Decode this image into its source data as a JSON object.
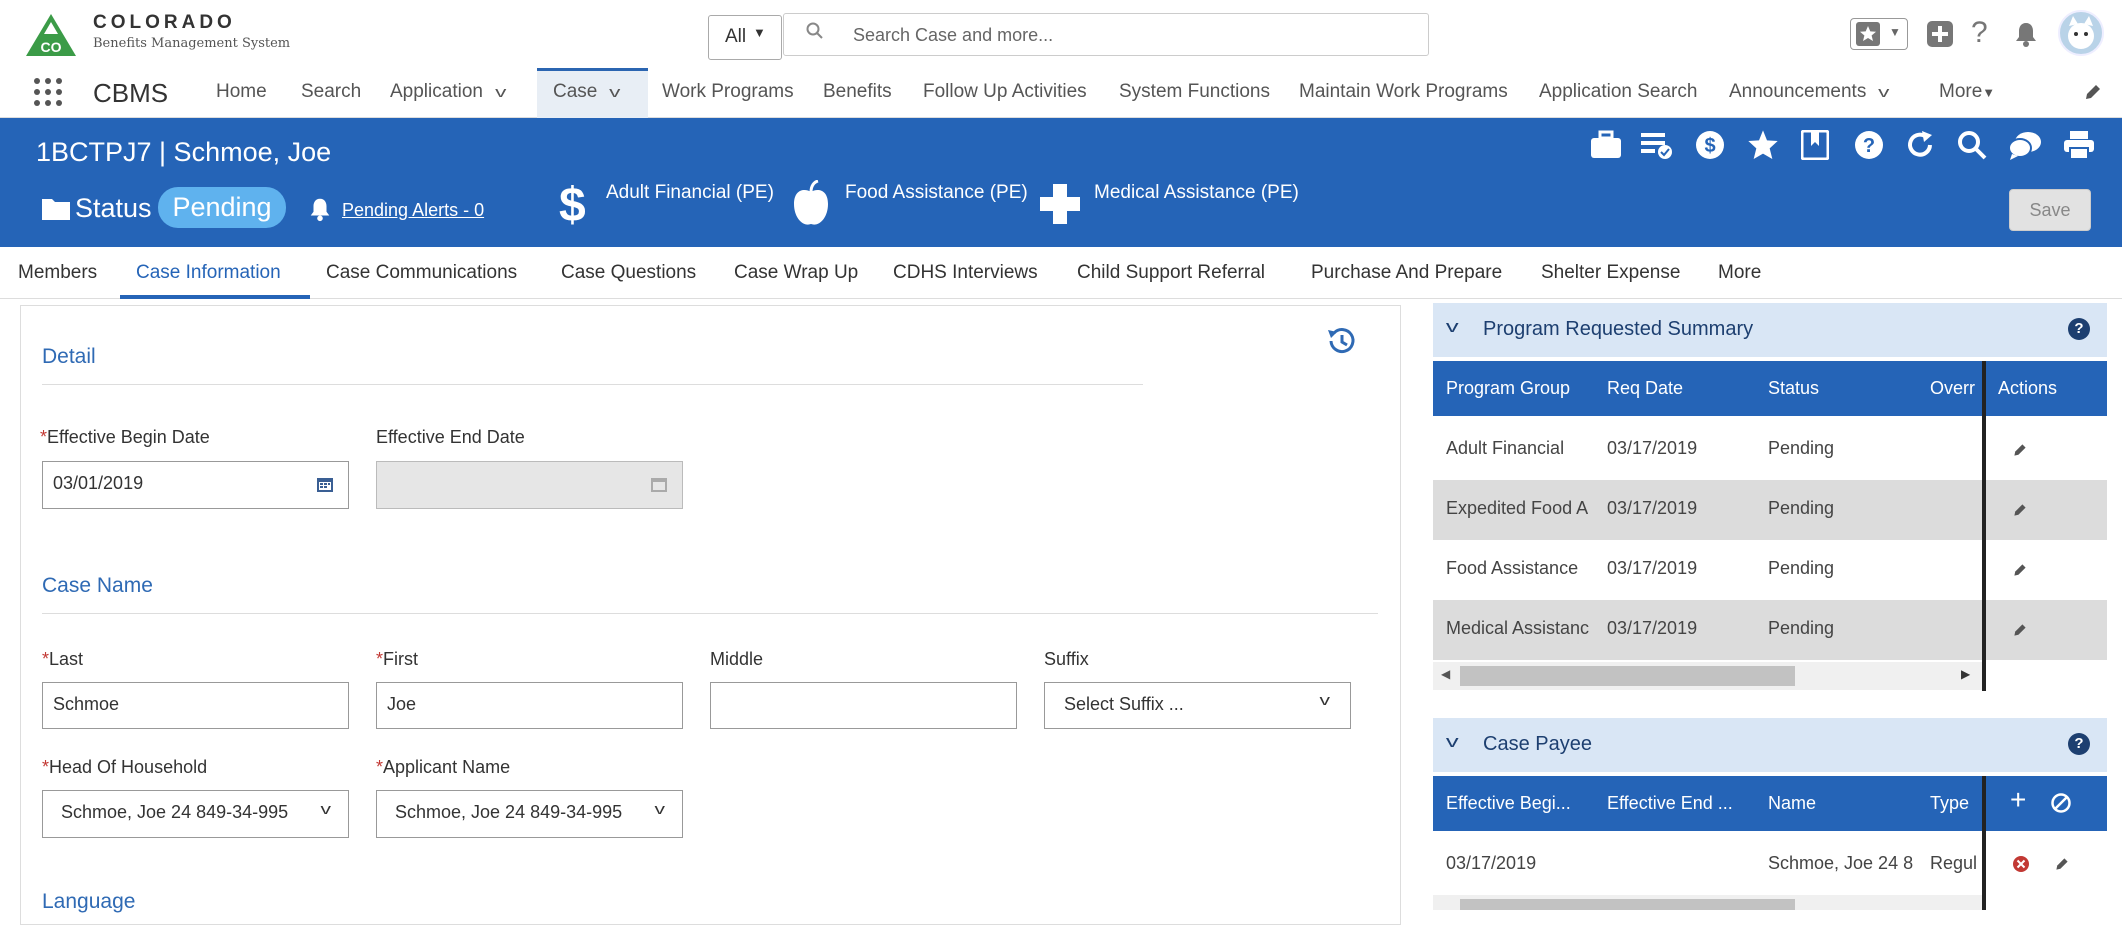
{
  "logo": {
    "title": "COLORADO",
    "subtitle": "Benefits Management System",
    "badge": "CO"
  },
  "search": {
    "scope": "All",
    "placeholder": "Search Case and more..."
  },
  "app_name": "CBMS",
  "nav": {
    "items": [
      "Home",
      "Search",
      "Application",
      "Case",
      "Work Programs",
      "Benefits",
      "Follow Up Activities",
      "System Functions",
      "Maintain Work Programs",
      "Application Search",
      "Announcements",
      "More"
    ],
    "active": "Case"
  },
  "case": {
    "title": "1BCTPJ7 | Schmoe, Joe",
    "status_label": "Status",
    "status_value": "Pending",
    "alerts": "Pending Alerts - 0",
    "programs": [
      "Adult Financial (PE)",
      "Food Assistance (PE)",
      "Medical Assistance (PE)"
    ],
    "save_label": "Save"
  },
  "tabs": {
    "items": [
      "Members",
      "Case Information",
      "Case Communications",
      "Case Questions",
      "Case Wrap Up",
      "CDHS Interviews",
      "Child Support Referral",
      "Purchase And Prepare",
      "Shelter Expense",
      "More"
    ],
    "active": "Case Information"
  },
  "detail": {
    "title": "Detail",
    "begin_label": "Effective Begin Date",
    "begin_value": "03/01/2019",
    "end_label": "Effective End Date",
    "end_value": ""
  },
  "case_name": {
    "title": "Case Name",
    "last_label": "Last",
    "last_value": "Schmoe",
    "first_label": "First",
    "first_value": "Joe",
    "middle_label": "Middle",
    "middle_value": "",
    "suffix_label": "Suffix",
    "suffix_value": "Select Suffix ...",
    "hoh_label": "Head Of Household",
    "hoh_value": "Schmoe, Joe 24 849-34-995",
    "applicant_label": "Applicant Name",
    "applicant_value": "Schmoe, Joe 24 849-34-995"
  },
  "language": {
    "title": "Language"
  },
  "program_summary": {
    "title": "Program Requested Summary",
    "columns": [
      "Program Group",
      "Req Date",
      "Status",
      "Overr",
      "Actions"
    ],
    "rows": [
      [
        "Adult Financial",
        "03/17/2019",
        "Pending"
      ],
      [
        "Expedited Food A",
        "03/17/2019",
        "Pending"
      ],
      [
        "Food Assistance",
        "03/17/2019",
        "Pending"
      ],
      [
        "Medical Assistanc",
        "03/17/2019",
        "Pending"
      ]
    ]
  },
  "case_payee": {
    "title": "Case Payee",
    "columns": [
      "Effective Begi...",
      "Effective End ...",
      "Name",
      "Type"
    ],
    "rows": [
      [
        "03/17/2019",
        "",
        "Schmoe, Joe 24 8",
        "Regul"
      ]
    ]
  },
  "colors": {
    "brand_blue": "#2564b7",
    "pending_pill": "#5fb2ee",
    "card_header": "#d9e6f5",
    "logo_green": "#3b9b47"
  },
  "icons": [
    "search-icon",
    "favorites-star-icon",
    "add-icon",
    "help-icon",
    "bell-icon",
    "avatar-icon",
    "waffle-icon",
    "edit-pencil-icon",
    "folder-icon",
    "dollar-icon",
    "apple-icon",
    "medical-cross-icon",
    "briefcase-icon",
    "list-check-icon",
    "dollar-circle-icon",
    "star-icon",
    "bookmark-icon",
    "refresh-icon",
    "magnifier-icon",
    "chat-icon",
    "print-icon",
    "history-icon",
    "calendar-icon",
    "chevron-down-icon",
    "delete-icon",
    "plus-icon",
    "cancel-icon"
  ]
}
